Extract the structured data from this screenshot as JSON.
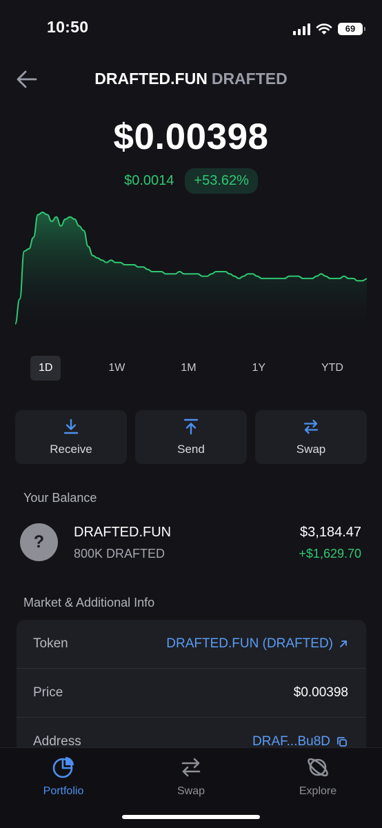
{
  "status_bar": {
    "time": "10:50",
    "battery": "69"
  },
  "header": {
    "token_name": "DRAFTED.FUN",
    "token_symbol": "DRAFTED"
  },
  "price": {
    "current": "$0.00398",
    "change_abs": "$0.0014",
    "change_pct": "+53.62%"
  },
  "chart_data": {
    "type": "area",
    "color": "#2fc872",
    "values": [
      0.002,
      0.0031,
      0.0052,
      0.0053,
      0.0058,
      0.0068,
      0.0069,
      0.0068,
      0.0065,
      0.0067,
      0.0063,
      0.0066,
      0.0067,
      0.0066,
      0.0063,
      0.0061,
      0.0054,
      0.005,
      0.0049,
      0.0048,
      0.0047,
      0.0048,
      0.0047,
      0.0047,
      0.0046,
      0.0046,
      0.0046,
      0.0045,
      0.0045,
      0.0044,
      0.0043,
      0.0043,
      0.0043,
      0.0042,
      0.0042,
      0.0042,
      0.0043,
      0.0042,
      0.0042,
      0.0042,
      0.0042,
      0.0041,
      0.0041,
      0.0042,
      0.0043,
      0.0043,
      0.0043,
      0.0042,
      0.0041,
      0.004,
      0.0041,
      0.0042,
      0.0042,
      0.0041,
      0.004,
      0.004,
      0.004,
      0.004,
      0.004,
      0.004,
      0.0041,
      0.0041,
      0.0041,
      0.004,
      0.004,
      0.004,
      0.0041,
      0.0042,
      0.0041,
      0.004,
      0.004,
      0.004,
      0.0041,
      0.004,
      0.004,
      0.0039,
      0.0039,
      0.00398
    ]
  },
  "ranges": [
    "1D",
    "1W",
    "1M",
    "1Y",
    "YTD"
  ],
  "active_range": "1D",
  "actions": {
    "receive": "Receive",
    "send": "Send",
    "swap": "Swap"
  },
  "balance": {
    "title": "Your Balance",
    "avatar_glyph": "?",
    "name": "DRAFTED.FUN",
    "amount": "800K DRAFTED",
    "value": "$3,184.47",
    "pnl": "+$1,629.70"
  },
  "market": {
    "title": "Market & Additional Info",
    "rows": [
      {
        "key": "Token",
        "value": "DRAFTED.FUN (DRAFTED)"
      },
      {
        "key": "Price",
        "value": "$0.00398"
      },
      {
        "key": "Address",
        "value": "DRAF...Bu8D"
      }
    ]
  },
  "tabs": {
    "portfolio": "Portfolio",
    "swap": "Swap",
    "explore": "Explore"
  },
  "colors": {
    "positive": "#2fc872",
    "accent": "#4d8ff0",
    "background": "#131318"
  }
}
